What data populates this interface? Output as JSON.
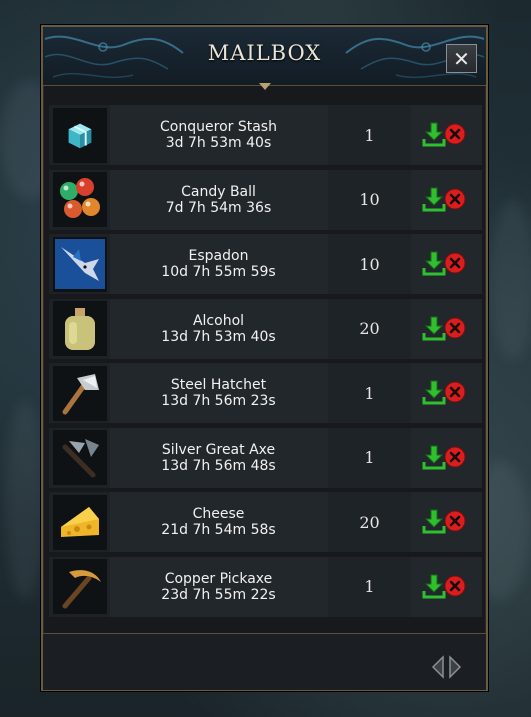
{
  "window": {
    "title": "MAILBOX",
    "close_symbol": "✕"
  },
  "colors": {
    "frame_gold": "#6b5b3e",
    "collect_green": "#2fbf2f",
    "delete_red": "#d81e1e"
  },
  "mail_items": [
    {
      "name": "Conqueror Stash",
      "time": "3d 7h 53m 40s",
      "quantity": "1",
      "icon": "gift-box-icon"
    },
    {
      "name": "Candy Ball",
      "time": "7d 7h 54m 36s",
      "quantity": "10",
      "icon": "candy-balls-icon"
    },
    {
      "name": "Espadon",
      "time": "10d 7h 55m 59s",
      "quantity": "10",
      "icon": "swordfish-icon"
    },
    {
      "name": "Alcohol",
      "time": "13d 7h 53m 40s",
      "quantity": "20",
      "icon": "bottle-icon"
    },
    {
      "name": "Steel Hatchet",
      "time": "13d 7h 56m 23s",
      "quantity": "1",
      "icon": "hatchet-icon"
    },
    {
      "name": "Silver Great Axe",
      "time": "13d 7h 56m 48s",
      "quantity": "1",
      "icon": "great-axe-icon"
    },
    {
      "name": "Cheese",
      "time": "21d 7h 54m 58s",
      "quantity": "20",
      "icon": "cheese-icon"
    },
    {
      "name": "Copper Pickaxe",
      "time": "23d 7h 55m 22s",
      "quantity": "1",
      "icon": "pickaxe-icon"
    }
  ],
  "actions": {
    "collect_icon": "download-arrow-icon",
    "delete_icon": "red-x-circle-icon"
  },
  "pagination": {
    "prev_icon": "arrow-left-icon",
    "next_icon": "arrow-right-icon"
  }
}
